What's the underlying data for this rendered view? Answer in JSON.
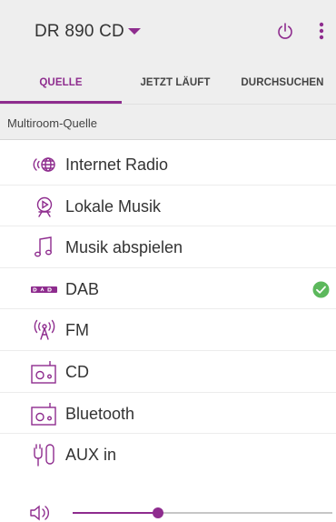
{
  "header": {
    "device_name": "DR 890 CD"
  },
  "tabs": [
    {
      "label": "QUELLE",
      "active": true
    },
    {
      "label": "JETZT LÄUFT",
      "active": false
    },
    {
      "label": "DURCHSUCHEN",
      "active": false
    }
  ],
  "section": {
    "title": "Multiroom-Quelle"
  },
  "sources": [
    {
      "label": "Internet Radio",
      "icon": "internet-radio-icon",
      "selected": false
    },
    {
      "label": "Lokale Musik",
      "icon": "local-music-icon",
      "selected": false
    },
    {
      "label": "Musik abspielen",
      "icon": "music-note-icon",
      "selected": false
    },
    {
      "label": "DAB",
      "icon": "dab-icon",
      "selected": true
    },
    {
      "label": "FM",
      "icon": "fm-antenna-icon",
      "selected": false
    },
    {
      "label": "CD",
      "icon": "cd-player-icon",
      "selected": false
    },
    {
      "label": "Bluetooth",
      "icon": "bluetooth-radio-icon",
      "selected": false
    },
    {
      "label": "AUX in",
      "icon": "aux-plug-icon",
      "selected": false
    }
  ],
  "volume": {
    "level": 0.33
  },
  "colors": {
    "accent": "#8e2c8e",
    "check": "#5cb85c",
    "header_bg": "#eeeeee"
  }
}
